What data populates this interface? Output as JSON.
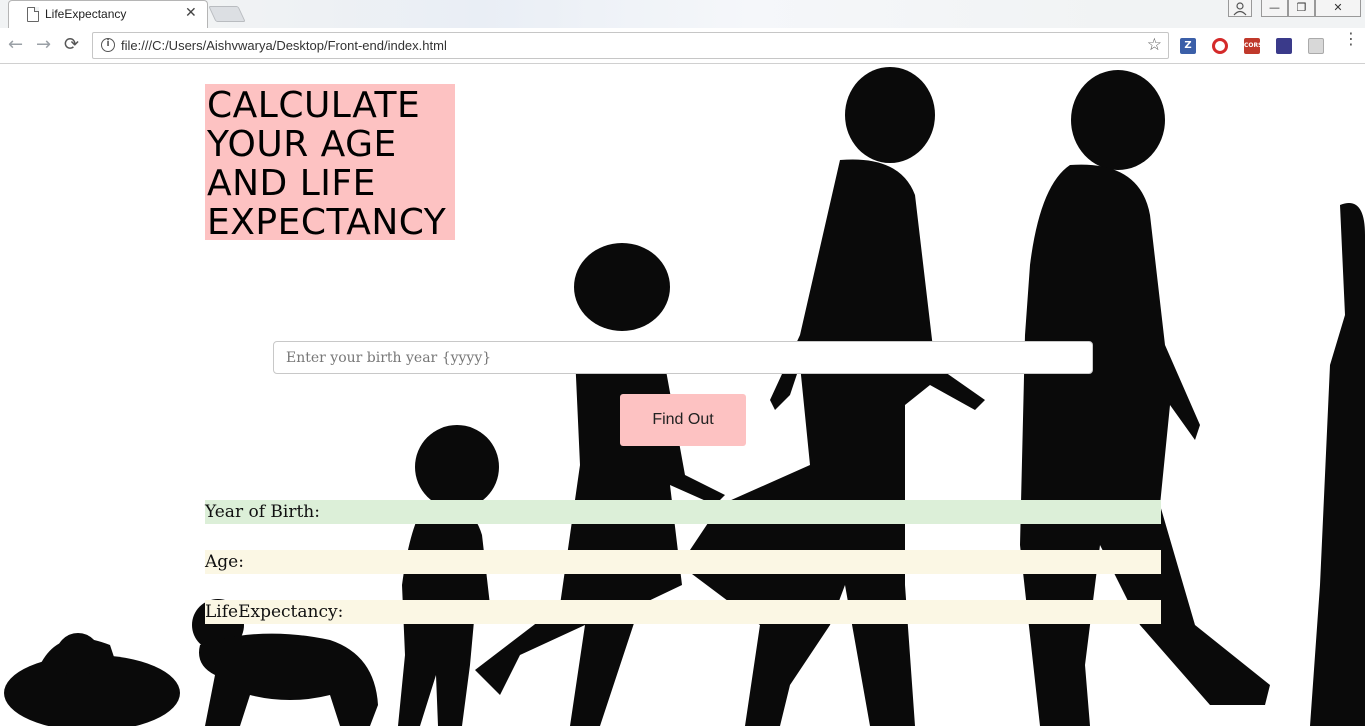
{
  "browser": {
    "tab_title": "LifeExpectancy",
    "url": "file:///C:/Users/Aishvwarya/Desktop/Front-end/index.html",
    "extensions": [
      {
        "name": "zotero-icon",
        "label": "Z",
        "color": "#3b5fa8"
      },
      {
        "name": "opera-icon",
        "label": "O",
        "color": "#d42a2a"
      },
      {
        "name": "cors-icon",
        "label": "CORS",
        "color": "#c0392b"
      },
      {
        "name": "extension-icon",
        "label": "",
        "color": "#3a3a8a"
      },
      {
        "name": "extension-gray-icon",
        "label": "",
        "color": "#b5b5b5"
      }
    ]
  },
  "header": {
    "title_lines": [
      "CALCULATE",
      "YOUR AGE",
      "AND LIFE",
      "EXPECTANCY"
    ],
    "bg_color": "#fdc2c2"
  },
  "form": {
    "placeholder": "Enter your birth year {yyyy}",
    "button_label": "Find Out",
    "button_color": "#fdc2c2"
  },
  "results": {
    "birth_label": "Year of Birth:",
    "age_label": "Age:",
    "life_label": "LifeExpectancy:",
    "birth_color": "#dcefd8",
    "row_color": "#fbf7e4"
  }
}
